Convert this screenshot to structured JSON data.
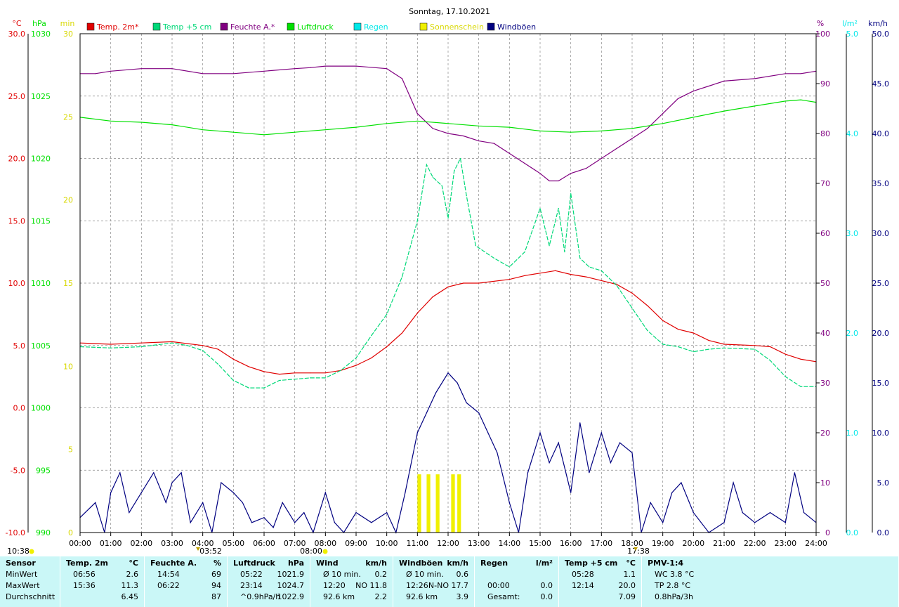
{
  "title": "Sonntag, 17.10.2021",
  "colors": {
    "temp2m": "#e00000",
    "temp5cm": "#00d878",
    "humidity": "#800080",
    "pressure": "#00e000",
    "rain": "#00e8e8",
    "sunshine": "#f0f000",
    "gusts": "#000080"
  },
  "legend": [
    {
      "label": "Temp. 2m*",
      "color": "#e00000"
    },
    {
      "label": "Temp +5 cm",
      "color": "#00d878"
    },
    {
      "label": "Feuchte A.*",
      "color": "#800080"
    },
    {
      "label": "Luftdruck",
      "color": "#00e000"
    },
    {
      "label": "Regen",
      "color": "#00e8e8"
    },
    {
      "label": "Sonnenschein",
      "color": "#f0f000"
    },
    {
      "label": "Windböen",
      "color": "#000080"
    }
  ],
  "axes": {
    "temp": {
      "unit": "°C",
      "ticks": [
        "30.0",
        "25.0",
        "20.0",
        "15.0",
        "10.0",
        "5.0",
        "0.0",
        "-5.0",
        "-10.0"
      ],
      "range": [
        -10,
        30
      ]
    },
    "pressure": {
      "unit": "hPa",
      "ticks": [
        "1030",
        "1025",
        "1020",
        "1015",
        "1010",
        "1005",
        "1000",
        "995",
        "990"
      ],
      "range": [
        990,
        1030
      ]
    },
    "sun": {
      "unit": "min",
      "ticks": [
        "30",
        "25",
        "20",
        "15",
        "10",
        "5",
        "0"
      ],
      "range": [
        0,
        30
      ]
    },
    "humidity": {
      "unit": "%",
      "ticks": [
        "100",
        "90",
        "80",
        "70",
        "60",
        "50",
        "40",
        "30",
        "20",
        "10",
        "0"
      ],
      "range": [
        0,
        100
      ]
    },
    "rain": {
      "unit": "l/m²",
      "ticks": [
        "5.0",
        "4.0",
        "3.0",
        "2.0",
        "1.0",
        "0.0"
      ],
      "range": [
        0,
        5
      ]
    },
    "wind": {
      "unit": "km/h",
      "ticks": [
        "50.0",
        "45.0",
        "40.0",
        "35.0",
        "30.0",
        "25.0",
        "20.0",
        "15.0",
        "10.0",
        "5.0",
        "0.0"
      ],
      "range": [
        0,
        50
      ]
    },
    "time_ticks": [
      "00:00",
      "01:00",
      "02:00",
      "03:00",
      "04:00",
      "05:00",
      "06:00",
      "07:00",
      "08:00",
      "09:00",
      "10:00",
      "11:00",
      "12:00",
      "13:00",
      "14:00",
      "15:00",
      "16:00",
      "17:00",
      "18:00",
      "19:00",
      "20:00",
      "21:00",
      "22:00",
      "23:00",
      "24:00"
    ]
  },
  "markers": {
    "sunrise_label": "10:38",
    "moonrise_label": "03:52",
    "sunrise_time": "08:00",
    "sunset_label": "17:38"
  },
  "chart_data": {
    "type": "line",
    "x_unit": "hours",
    "series": [
      {
        "name": "Temp. 2m*",
        "axis": "temp",
        "points": [
          [
            0,
            5.2
          ],
          [
            1,
            5.1
          ],
          [
            2,
            5.2
          ],
          [
            3,
            5.3
          ],
          [
            4,
            5.0
          ],
          [
            4.5,
            4.7
          ],
          [
            5,
            3.9
          ],
          [
            5.5,
            3.3
          ],
          [
            6,
            2.9
          ],
          [
            6.5,
            2.7
          ],
          [
            7,
            2.8
          ],
          [
            7.5,
            2.8
          ],
          [
            8,
            2.8
          ],
          [
            8.5,
            3.0
          ],
          [
            9,
            3.4
          ],
          [
            9.5,
            4.0
          ],
          [
            10,
            4.9
          ],
          [
            10.5,
            6.0
          ],
          [
            11,
            7.6
          ],
          [
            11.5,
            8.9
          ],
          [
            12,
            9.7
          ],
          [
            12.5,
            10.0
          ],
          [
            13,
            10.0
          ],
          [
            14,
            10.3
          ],
          [
            14.5,
            10.6
          ],
          [
            15,
            10.8
          ],
          [
            15.5,
            11.0
          ],
          [
            16,
            10.7
          ],
          [
            16.5,
            10.5
          ],
          [
            17,
            10.2
          ],
          [
            17.5,
            9.9
          ],
          [
            18,
            9.2
          ],
          [
            18.5,
            8.2
          ],
          [
            19,
            7.0
          ],
          [
            19.5,
            6.3
          ],
          [
            20,
            6.0
          ],
          [
            20.5,
            5.4
          ],
          [
            21,
            5.1
          ],
          [
            22,
            5.0
          ],
          [
            22.5,
            4.9
          ],
          [
            23,
            4.3
          ],
          [
            23.5,
            3.9
          ],
          [
            24,
            3.7
          ]
        ]
      },
      {
        "name": "Temp +5 cm",
        "axis": "temp",
        "points": [
          [
            0,
            4.9
          ],
          [
            1,
            4.8
          ],
          [
            2,
            4.9
          ],
          [
            3,
            5.2
          ],
          [
            3.5,
            5.0
          ],
          [
            4,
            4.6
          ],
          [
            4.5,
            3.5
          ],
          [
            5,
            2.2
          ],
          [
            5.5,
            1.6
          ],
          [
            6,
            1.6
          ],
          [
            6.5,
            2.2
          ],
          [
            7,
            2.3
          ],
          [
            7.5,
            2.4
          ],
          [
            8,
            2.4
          ],
          [
            8.5,
            3.0
          ],
          [
            9,
            4.0
          ],
          [
            9.5,
            5.8
          ],
          [
            10,
            7.5
          ],
          [
            10.5,
            10.5
          ],
          [
            11,
            15.0
          ],
          [
            11.3,
            19.5
          ],
          [
            11.5,
            18.5
          ],
          [
            11.8,
            17.8
          ],
          [
            12,
            15.2
          ],
          [
            12.2,
            19.0
          ],
          [
            12.4,
            20.0
          ],
          [
            12.6,
            17.0
          ],
          [
            12.9,
            13.0
          ],
          [
            13.5,
            12.0
          ],
          [
            14,
            11.3
          ],
          [
            14.5,
            12.5
          ],
          [
            15,
            16.0
          ],
          [
            15.3,
            13.0
          ],
          [
            15.6,
            16.0
          ],
          [
            15.8,
            12.5
          ],
          [
            16,
            17.2
          ],
          [
            16.3,
            12.0
          ],
          [
            16.6,
            11.3
          ],
          [
            17,
            11.0
          ],
          [
            17.5,
            9.8
          ],
          [
            18,
            8.0
          ],
          [
            18.5,
            6.2
          ],
          [
            19,
            5.1
          ],
          [
            19.5,
            4.9
          ],
          [
            20,
            4.5
          ],
          [
            20.5,
            4.7
          ],
          [
            21,
            4.8
          ],
          [
            22,
            4.7
          ],
          [
            22.5,
            3.8
          ],
          [
            23,
            2.5
          ],
          [
            23.5,
            1.7
          ],
          [
            24,
            1.7
          ]
        ]
      },
      {
        "name": "Feuchte A.*",
        "axis": "humidity",
        "points": [
          [
            0,
            92
          ],
          [
            0.5,
            92
          ],
          [
            1,
            92.5
          ],
          [
            2,
            93
          ],
          [
            3,
            93
          ],
          [
            4,
            92
          ],
          [
            5,
            92
          ],
          [
            6,
            92.5
          ],
          [
            7,
            93
          ],
          [
            7.5,
            93.2
          ],
          [
            8,
            93.5
          ],
          [
            9,
            93.5
          ],
          [
            10,
            93
          ],
          [
            10.5,
            91
          ],
          [
            11,
            84
          ],
          [
            11.5,
            81
          ],
          [
            12,
            80
          ],
          [
            12.5,
            79.5
          ],
          [
            13,
            78.5
          ],
          [
            13.5,
            78
          ],
          [
            14,
            76
          ],
          [
            14.5,
            74
          ],
          [
            15,
            72
          ],
          [
            15.3,
            70.5
          ],
          [
            15.6,
            70.5
          ],
          [
            16,
            72
          ],
          [
            16.5,
            73
          ],
          [
            17,
            75
          ],
          [
            17.5,
            77
          ],
          [
            18,
            79
          ],
          [
            18.5,
            81
          ],
          [
            19,
            84
          ],
          [
            19.5,
            87
          ],
          [
            20,
            88.5
          ],
          [
            20.5,
            89.5
          ],
          [
            21,
            90.5
          ],
          [
            22,
            91
          ],
          [
            23,
            92
          ],
          [
            23.5,
            92
          ],
          [
            24,
            92.5
          ]
        ]
      },
      {
        "name": "Luftdruck",
        "axis": "pressure",
        "points": [
          [
            0,
            1023.3
          ],
          [
            1,
            1023.0
          ],
          [
            2,
            1022.9
          ],
          [
            3,
            1022.7
          ],
          [
            4,
            1022.3
          ],
          [
            5,
            1022.1
          ],
          [
            6,
            1021.9
          ],
          [
            7,
            1022.1
          ],
          [
            8,
            1022.3
          ],
          [
            9,
            1022.5
          ],
          [
            10,
            1022.8
          ],
          [
            11,
            1023.0
          ],
          [
            12,
            1022.8
          ],
          [
            13,
            1022.6
          ],
          [
            14,
            1022.5
          ],
          [
            15,
            1022.2
          ],
          [
            16,
            1022.1
          ],
          [
            17,
            1022.2
          ],
          [
            18,
            1022.4
          ],
          [
            19,
            1022.8
          ],
          [
            20,
            1023.3
          ],
          [
            21,
            1023.8
          ],
          [
            22,
            1024.2
          ],
          [
            23,
            1024.6
          ],
          [
            23.5,
            1024.7
          ],
          [
            24,
            1024.5
          ]
        ]
      },
      {
        "name": "Windböen",
        "axis": "wind",
        "points": [
          [
            0,
            1.5
          ],
          [
            0.5,
            3
          ],
          [
            0.8,
            0
          ],
          [
            1,
            4
          ],
          [
            1.3,
            6
          ],
          [
            1.6,
            2
          ],
          [
            2,
            4
          ],
          [
            2.4,
            6
          ],
          [
            2.8,
            3
          ],
          [
            3,
            5
          ],
          [
            3.3,
            6
          ],
          [
            3.6,
            1
          ],
          [
            4,
            3
          ],
          [
            4.3,
            0
          ],
          [
            4.6,
            5
          ],
          [
            5,
            4
          ],
          [
            5.3,
            3
          ],
          [
            5.6,
            1
          ],
          [
            6,
            1.5
          ],
          [
            6.3,
            0.5
          ],
          [
            6.6,
            3
          ],
          [
            7,
            1
          ],
          [
            7.3,
            2
          ],
          [
            7.6,
            0
          ],
          [
            8,
            4
          ],
          [
            8.3,
            1
          ],
          [
            8.6,
            0
          ],
          [
            9,
            2
          ],
          [
            9.5,
            1
          ],
          [
            10,
            2
          ],
          [
            10.3,
            0
          ],
          [
            10.6,
            4
          ],
          [
            11,
            10
          ],
          [
            11.3,
            12
          ],
          [
            11.6,
            14
          ],
          [
            12,
            16
          ],
          [
            12.3,
            15
          ],
          [
            12.6,
            13
          ],
          [
            13,
            12
          ],
          [
            13.3,
            10
          ],
          [
            13.6,
            8
          ],
          [
            14,
            3
          ],
          [
            14.3,
            0
          ],
          [
            14.6,
            6
          ],
          [
            15,
            10
          ],
          [
            15.3,
            7
          ],
          [
            15.6,
            9
          ],
          [
            16,
            4
          ],
          [
            16.3,
            11
          ],
          [
            16.6,
            6
          ],
          [
            17,
            10
          ],
          [
            17.3,
            7
          ],
          [
            17.6,
            9
          ],
          [
            18,
            8
          ],
          [
            18.3,
            0
          ],
          [
            18.6,
            3
          ],
          [
            19,
            1
          ],
          [
            19.3,
            4
          ],
          [
            19.6,
            5
          ],
          [
            20,
            2
          ],
          [
            20.5,
            0
          ],
          [
            21,
            1
          ],
          [
            21.3,
            5
          ],
          [
            21.6,
            2
          ],
          [
            22,
            1
          ],
          [
            22.5,
            2
          ],
          [
            23,
            1
          ],
          [
            23.3,
            6
          ],
          [
            23.6,
            2
          ],
          [
            24,
            1
          ]
        ]
      }
    ],
    "sunshine_minutes": [
      [
        11.0,
        3.5
      ],
      [
        11.3,
        3.5
      ],
      [
        11.6,
        3.5
      ],
      [
        12.1,
        3.5
      ],
      [
        12.3,
        3.5
      ]
    ],
    "rain": []
  },
  "summary": {
    "columns": [
      {
        "header": [
          "Sensor",
          ""
        ],
        "rows": [
          [
            "MinWert",
            ""
          ],
          [
            "MaxWert",
            ""
          ],
          [
            "Durchschnitt",
            ""
          ]
        ]
      },
      {
        "header": [
          "Temp. 2m",
          "°C"
        ],
        "rows": [
          [
            "06:56",
            "2.6"
          ],
          [
            "15:36",
            "11.3"
          ],
          [
            "",
            "6.45"
          ]
        ]
      },
      {
        "header": [
          "Feuchte A.",
          "%"
        ],
        "rows": [
          [
            "14:54",
            "69"
          ],
          [
            "06:22",
            "94"
          ],
          [
            "",
            "87"
          ]
        ]
      },
      {
        "header": [
          "Luftdruck",
          "hPa"
        ],
        "rows": [
          [
            "05:22",
            "1021.9"
          ],
          [
            "23:14",
            "1024.7"
          ],
          [
            "^0.9hPa/h",
            "1022.9"
          ]
        ]
      },
      {
        "header": [
          "Wind",
          "km/h"
        ],
        "rows": [
          [
            "Ø 10 min.",
            "0.2"
          ],
          [
            "12:20",
            "NO 11.8"
          ],
          [
            "92.6 km",
            "2.2"
          ]
        ]
      },
      {
        "header": [
          "Windböen",
          "km/h"
        ],
        "rows": [
          [
            "Ø 10 min.",
            "0.6"
          ],
          [
            "12:26",
            "N-NO 17.7"
          ],
          [
            "92.6 km",
            "3.9"
          ]
        ]
      },
      {
        "header": [
          "Regen",
          "l/m²"
        ],
        "rows": [
          [
            "",
            ""
          ],
          [
            "00:00",
            "0.0"
          ],
          [
            "Gesamt:",
            "0.0"
          ]
        ]
      },
      {
        "header": [
          "Temp +5 cm",
          "°C"
        ],
        "rows": [
          [
            "05:28",
            "1.1"
          ],
          [
            "12:14",
            "20.0"
          ],
          [
            "",
            "7.09"
          ]
        ]
      },
      {
        "header": [
          "PMV-1:4",
          ""
        ],
        "rows": [
          [
            "WC 3.8 °C",
            ""
          ],
          [
            "TP 2.8 °C",
            ""
          ],
          [
            "0.8hPa/3h",
            ""
          ]
        ]
      }
    ]
  }
}
